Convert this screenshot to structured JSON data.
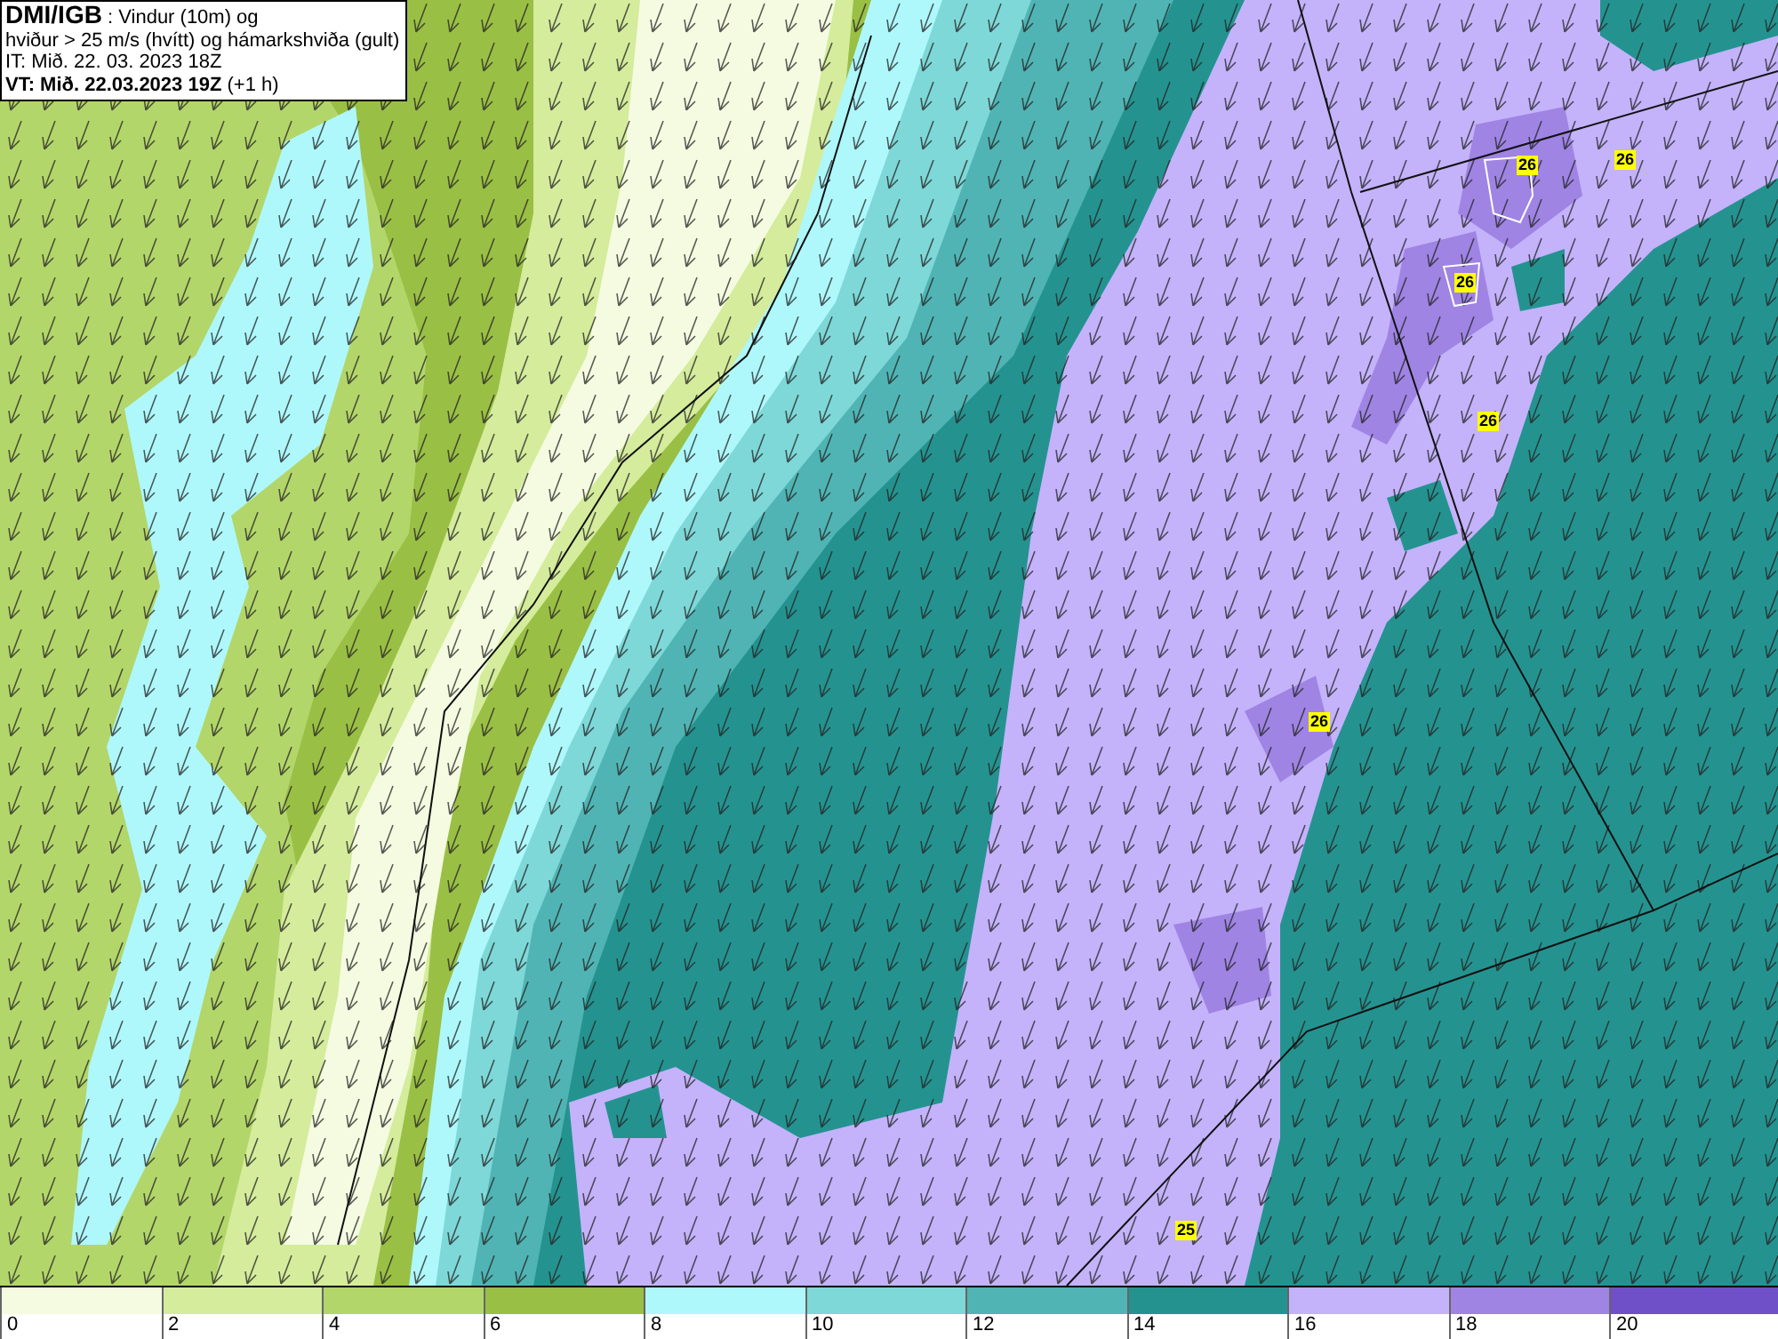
{
  "header": {
    "lines": [
      "**DMI/IGB** : Vindur (10m) og",
      "hviður > 25 m/s (hvítt) og hámarkshviða (gult)",
      "IT: Mið. 22. 03. 2023 18Z",
      "**VT: Mið. 22.03.2023 19Z** (+1 h)"
    ]
  },
  "gust_labels": [
    "26",
    "26",
    "26",
    "26",
    "26",
    "25"
  ],
  "legend": [
    {
      "tick": "0",
      "color": "#f4fbe0"
    },
    {
      "tick": "2",
      "color": "#d4ec9c"
    },
    {
      "tick": "4",
      "color": "#b3d66a"
    },
    {
      "tick": "6",
      "color": "#9abf45"
    },
    {
      "tick": "8",
      "color": "#aef8fc"
    },
    {
      "tick": "10",
      "color": "#7ed8d8"
    },
    {
      "tick": "12",
      "color": "#50b4b4"
    },
    {
      "tick": "14",
      "color": "#249390"
    },
    {
      "tick": "16",
      "color": "#c4b2fb"
    },
    {
      "tick": "18",
      "color": "#9f84e4"
    },
    {
      "tick": "20",
      "color": "#7050c8"
    }
  ]
}
